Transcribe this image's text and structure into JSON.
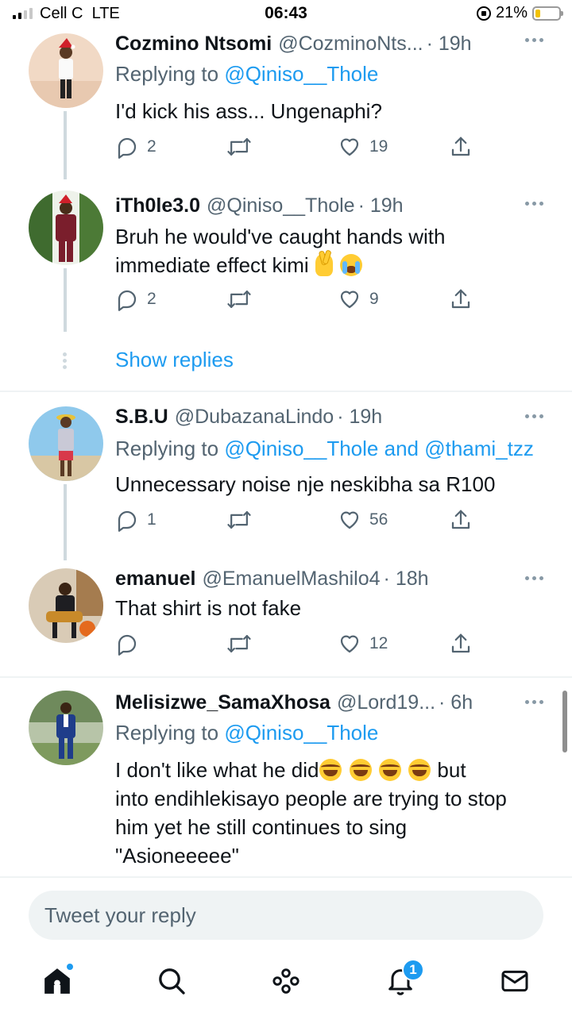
{
  "status_bar": {
    "carrier": "Cell C",
    "network": "LTE",
    "time": "06:43",
    "battery": "21%",
    "battery_level": 0.21
  },
  "tweets": [
    {
      "name": "Cozmino Ntsomi",
      "handle": "@CozminoNts...",
      "time": "· 19h",
      "replying_prefix": "Replying to",
      "replying_to": "@Qiniso__Thole",
      "text": "I'd kick his ass... Ungenaphi?",
      "replies": "2",
      "likes": "19"
    },
    {
      "name": "iTh0le3.0",
      "handle": "@Qiniso__Thole",
      "time": "· 19h",
      "text_line1": "Bruh he would've caught hands with",
      "text_line2": "immediate effect kimi",
      "replies": "2",
      "likes": "9"
    },
    {
      "name": "S.B.U",
      "handle": "@DubazanaLindo",
      "time": "· 19h",
      "replying_prefix": "Replying to",
      "replying_to": "@Qiniso__Thole",
      "replying_and": "and",
      "replying_to_2": "@thami_tzz",
      "text": "Unnecessary noise nje neskibha sa R100",
      "replies": "1",
      "likes": "56"
    },
    {
      "name": "emanuel",
      "handle": "@EmanuelMashilo4",
      "time": "· 18h",
      "text": "That shirt is not fake",
      "replies": "",
      "likes": "12"
    },
    {
      "name": "Melisizwe_SamaXhosa",
      "handle": "@Lord19...",
      "time": "· 6h",
      "replying_prefix": "Replying to",
      "replying_to": "@Qiniso__Thole",
      "text_line1_a": "I don't like what he did",
      "text_line1_b": " but",
      "text_line2": "into endihlekisayo people are trying to stop",
      "text_line3": "him yet he still continues to sing",
      "text_line4": "\"Asioneeeee\""
    }
  ],
  "show_replies": "Show replies",
  "reply_box": {
    "placeholder": "Tweet your reply"
  },
  "nav": {
    "notification_count": "1"
  },
  "icons": {
    "reply": "reply-icon",
    "retweet": "retweet-icon",
    "like": "like-icon",
    "share": "share-icon",
    "home": "home-icon",
    "search": "search-icon",
    "spaces": "spaces-icon",
    "notifications": "bell-icon",
    "messages": "mail-icon"
  },
  "colors": {
    "accent": "#1d9bf0",
    "secondary_text": "#536471",
    "primary_text": "#0f1419"
  }
}
